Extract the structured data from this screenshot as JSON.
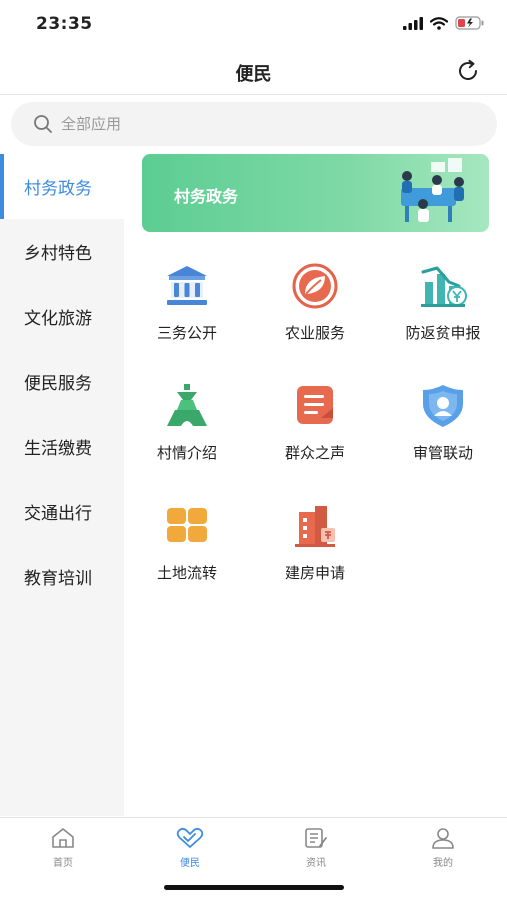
{
  "status": {
    "time": "23:35"
  },
  "nav": {
    "title": "便民"
  },
  "search": {
    "placeholder": "全部应用"
  },
  "sidebar": {
    "items": [
      {
        "label": "村务政务",
        "active": true
      },
      {
        "label": "乡村特色"
      },
      {
        "label": "文化旅游"
      },
      {
        "label": "便民服务"
      },
      {
        "label": "生活缴费"
      },
      {
        "label": "交通出行"
      },
      {
        "label": "教育培训"
      }
    ]
  },
  "banner": {
    "title": "村务政务"
  },
  "tiles": [
    {
      "label": "三务公开",
      "icon": "building-icon"
    },
    {
      "label": "农业服务",
      "icon": "leaf-icon"
    },
    {
      "label": "防返贫申报",
      "icon": "chart-yen-icon"
    },
    {
      "label": "村情介绍",
      "icon": "tower-icon"
    },
    {
      "label": "群众之声",
      "icon": "note-icon"
    },
    {
      "label": "审管联动",
      "icon": "badge-icon"
    },
    {
      "label": "土地流转",
      "icon": "grid-icon"
    },
    {
      "label": "建房申请",
      "icon": "house-icon"
    }
  ],
  "tabbar": {
    "items": [
      {
        "label": "首页",
        "icon": "home-icon"
      },
      {
        "label": "便民",
        "icon": "heart-hands-icon",
        "active": true
      },
      {
        "label": "资讯",
        "icon": "news-icon"
      },
      {
        "label": "我的",
        "icon": "user-icon"
      }
    ]
  },
  "colors": {
    "accent": "#3d8ce0",
    "banner": "#5ccd92"
  }
}
